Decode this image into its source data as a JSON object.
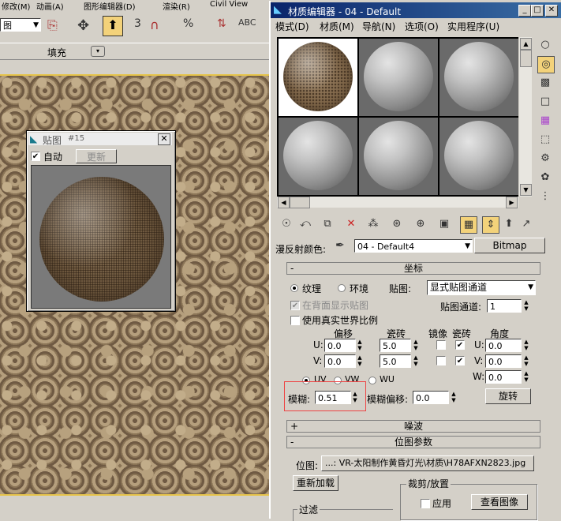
{
  "app": {
    "menu": [
      "修改(M)",
      "动画(A)",
      "图形编辑器(D)",
      "渲染(R)",
      "Civil View"
    ],
    "toolbar_dropdown": "图",
    "fill_label": "填充"
  },
  "map_window": {
    "title": "贴图",
    "number": "#15",
    "auto_label": "自动",
    "update_button": "更新",
    "close": "✕"
  },
  "material_editor": {
    "title": "材质编辑器 - 04 - Default",
    "window_buttons": [
      "_",
      "□",
      "✕"
    ],
    "menu": [
      "模式(D)",
      "材质(M)",
      "导航(N)",
      "选项(O)",
      "实用程序(U)"
    ],
    "diffuse_label": "漫反射颜色:",
    "material_name": "04 - Default4",
    "bitmap_button": "Bitmap",
    "coords": {
      "header": "坐标",
      "sign": "-",
      "texture_label": "纹理",
      "environ_label": "环境",
      "mapping_label": "贴图:",
      "mapping_value": "显式贴图通道",
      "show_back_label": "在背面显示贴图",
      "map_channel_label": "贴图通道:",
      "map_channel_value": "1",
      "real_world_label": "使用真实世界比例",
      "offset_label": "偏移",
      "tiling_label": "瓷砖",
      "mirror_label": "镜像",
      "tile_label": "瓷砖",
      "angle_label": "角度",
      "u_label": "U:",
      "v_label": "V:",
      "w_label": "W:",
      "u_offset": "0.0",
      "v_offset": "0.0",
      "u_tiling": "5.0",
      "v_tiling": "5.0",
      "u_angle": "0.0",
      "v_angle": "0.0",
      "w_angle": "0.0",
      "uv_label": "UV",
      "vw_label": "VW",
      "wu_label": "WU",
      "blur_label": "模糊:",
      "blur_value": "0.51",
      "blur_offset_label": "模糊偏移:",
      "blur_offset_value": "0.0",
      "rotate_button": "旋转"
    },
    "noise_header": "噪波",
    "noise_sign": "+",
    "bitmap_params_header": "位图参数",
    "bitmap_params_sign": "-",
    "bitmap_label": "位图:",
    "bitmap_path": "...: VR-太阳制作黄昏灯光\\材质\\H78AFXN2823.jpg",
    "reload_button": "重新加载",
    "crop_label": "裁剪/放置",
    "apply_label": "应用",
    "view_image_button": "查看图像",
    "filter_label": "过滤"
  }
}
